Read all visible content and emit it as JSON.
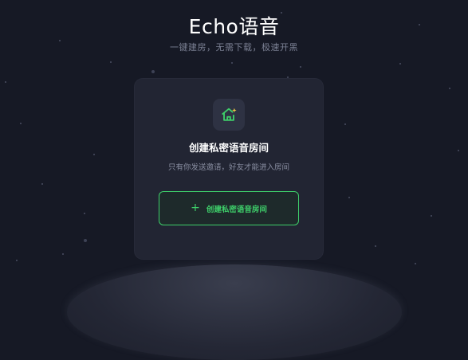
{
  "header": {
    "title": "Echo语音",
    "subtitle": "一键建房，无需下载，极速开黑"
  },
  "card": {
    "icon": "house-sparkle-icon",
    "title": "创建私密语音房间",
    "description": "只有你发送邀请，好友才能进入房间",
    "button_icon": "plus-icon",
    "button_label": "创建私密语音房间"
  },
  "colors": {
    "background": "#161925",
    "card": "#222533",
    "accent": "#3ecf6a"
  }
}
